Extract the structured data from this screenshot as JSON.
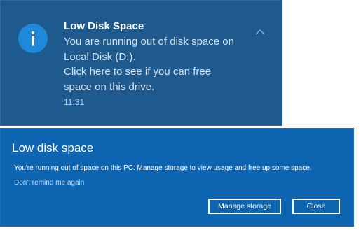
{
  "toast": {
    "title": "Low Disk Space",
    "body_lines": [
      "You are running out of disk space on",
      "Local Disk (D:).",
      "Click here to see if you can free",
      "space on this drive."
    ],
    "time": "11:31",
    "icon": "info-icon",
    "collapse_icon": "chevron-up-icon",
    "background_color": "#1f5a8f",
    "icon_color": "#1e88d9"
  },
  "dialog": {
    "title": "Low disk space",
    "message": "You're running out of space on this PC. Manage storage to view usage and free up some space.",
    "link_label": "Don't remind me again",
    "manage_label": "Manage storage",
    "close_label": "Close",
    "background_color": "#0d64b1"
  }
}
